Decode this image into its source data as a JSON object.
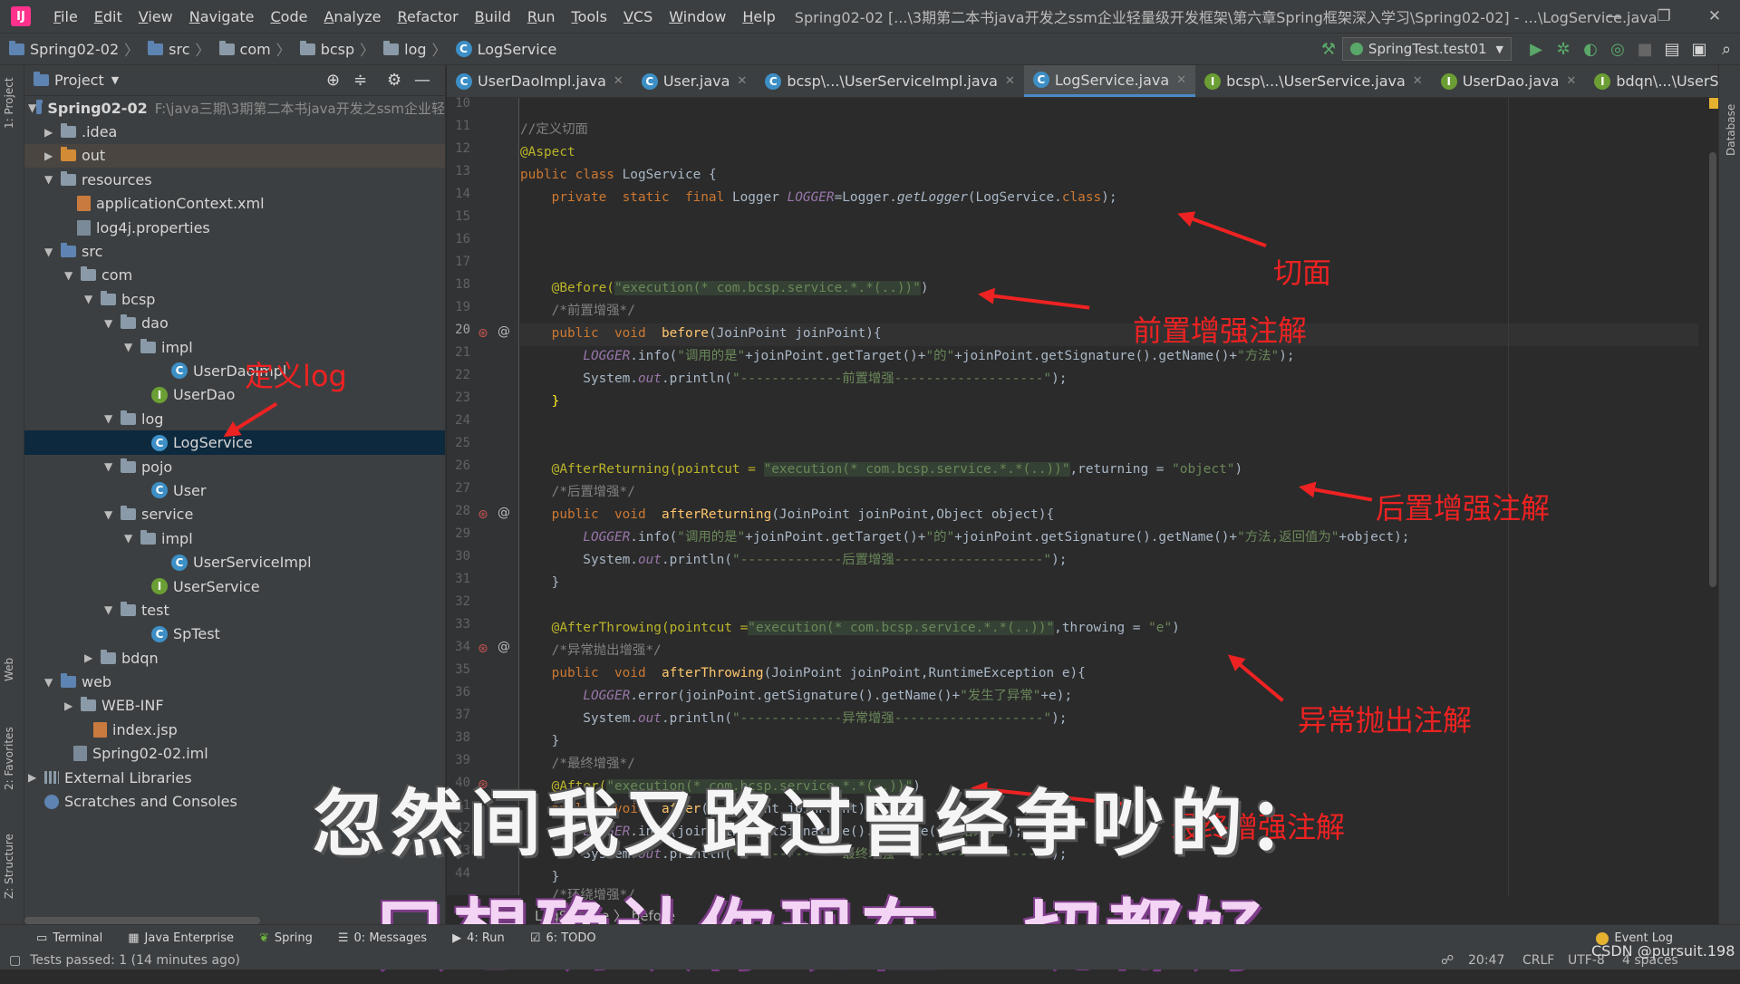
{
  "window": {
    "app_icon": "IJ",
    "menus": [
      "File",
      "Edit",
      "View",
      "Navigate",
      "Code",
      "Analyze",
      "Refactor",
      "Build",
      "Run",
      "Tools",
      "VCS",
      "Window",
      "Help"
    ],
    "title": "Spring02-02 [...\\3期第二本书java开发之ssm企业轻量级开发框架\\第六章Spring框架深入学习\\Spring02-02] - ...\\LogService.java"
  },
  "navbar": {
    "crumbs": [
      "Spring02-02",
      "src",
      "com",
      "bcsp",
      "log",
      "LogService"
    ],
    "run_config": "SpringTest.test01"
  },
  "project_panel": {
    "title": "Project",
    "tree": [
      {
        "label": "Spring02-02",
        "path": "F:\\java三期\\3期第二本书java开发之ssm企业轻"
      },
      {
        "label": ".idea"
      },
      {
        "label": "out"
      },
      {
        "label": "resources"
      },
      {
        "label": "applicationContext.xml"
      },
      {
        "label": "log4j.properties"
      },
      {
        "label": "src"
      },
      {
        "label": "com"
      },
      {
        "label": "bcsp"
      },
      {
        "label": "dao"
      },
      {
        "label": "impl"
      },
      {
        "label": "UserDaoImpl"
      },
      {
        "label": "UserDao"
      },
      {
        "label": "log"
      },
      {
        "label": "LogService"
      },
      {
        "label": "pojo"
      },
      {
        "label": "User"
      },
      {
        "label": "service"
      },
      {
        "label": "impl"
      },
      {
        "label": "UserServiceImpl"
      },
      {
        "label": "UserService"
      },
      {
        "label": "test"
      },
      {
        "label": "SpTest"
      },
      {
        "label": "bdqn"
      },
      {
        "label": "web"
      },
      {
        "label": "WEB-INF"
      },
      {
        "label": "index.jsp"
      },
      {
        "label": "Spring02-02.iml"
      },
      {
        "label": "External Libraries"
      },
      {
        "label": "Scratches and Consoles"
      }
    ]
  },
  "tabs": [
    "UserDaoImpl.java",
    "User.java",
    "bcsp\\...\\UserServiceImpl.java",
    "LogService.java",
    "bcsp\\...\\UserService.java",
    "UserDao.java",
    "bdqn\\...\\UserService."
  ],
  "line_numbers": [
    "10",
    "11",
    "12",
    "13",
    "14",
    "15",
    "16",
    "17",
    "18",
    "19",
    "20",
    "21",
    "22",
    "23",
    "24",
    "25",
    "26",
    "27",
    "28",
    "29",
    "30",
    "31",
    "32",
    "33",
    "34",
    "35",
    "36",
    "37",
    "38",
    "39",
    "40",
    "41",
    "42",
    "43",
    "44"
  ],
  "code": {
    "l11": "//定义切面",
    "l12": "@Aspect",
    "l13a": "public class ",
    "l13b": "LogService {",
    "l14a": "    private  static  final ",
    "l14b": "Logger ",
    "l14c": "LOGGER",
    "l14d": "=Logger.",
    "l14e": "getLogger",
    "l14f": "(LogService.",
    "l14g": "class",
    "l14h": ");",
    "l18a": "    @Before(",
    "l18b": "\"execution(* com.bcsp.service.*.*(..))\"",
    "l18c": ")",
    "l19": "    /*前置增强*/",
    "l20a": "    public  void  ",
    "l20b": "before",
    "l20c": "(JoinPoint joinPoint){",
    "l21a": "        ",
    "l21b": "LOGGER",
    "l21c": ".info(",
    "l21d": "\"调用的是\"",
    "l21e": "+joinPoint.getTarget()+",
    "l21f": "\"的\"",
    "l21g": "+joinPoint.getSignature().getName()+",
    "l21h": "\"方法\"",
    "l21i": ");",
    "l22a": "        System.",
    "l22b": "out",
    "l22c": ".println(",
    "l22d": "\"-------------前置增强-------------------\"",
    "l22e": ");",
    "l23": "    }",
    "l26a": "    @AfterReturning(pointcut = ",
    "l26b": "\"execution(* com.bcsp.service.*.*(..))\"",
    "l26c": ",returning = ",
    "l26d": "\"object\"",
    "l26e": ")",
    "l27": "    /*后置增强*/",
    "l28a": "    public  void  ",
    "l28b": "afterReturning",
    "l28c": "(JoinPoint joinPoint,Object object){",
    "l29a": "        ",
    "l29b": "LOGGER",
    "l29c": ".info(",
    "l29d": "\"调用的是\"",
    "l29e": "+joinPoint.getTarget()+",
    "l29f": "\"的\"",
    "l29g": "+joinPoint.getSignature().getName()+",
    "l29h": "\"方法,返回值为\"",
    "l29i": "+object);",
    "l30a": "        System.",
    "l30b": "out",
    "l30c": ".println(",
    "l30d": "\"-------------后置增强-------------------\"",
    "l30e": ");",
    "l31": "    }",
    "l33a": "    @AfterThrowing(pointcut =",
    "l33b": "\"execution(* com.bcsp.service.*.*(..))\"",
    "l33c": ",throwing = ",
    "l33d": "\"e\"",
    "l33e": ")",
    "l34": "    /*异常抛出增强*/",
    "l35a": "    public  void  ",
    "l35b": "afterThrowing",
    "l35c": "(JoinPoint joinPoint,RuntimeException e){",
    "l36a": "        ",
    "l36b": "LOGGER",
    "l36c": ".error(joinPoint.getSignature().getName()+",
    "l36d": "\"发生了异常\"",
    "l36e": "+e);",
    "l37a": "        System.",
    "l37b": "out",
    "l37c": ".println(",
    "l37d": "\"-------------异常增强-------------------\"",
    "l37e": ");",
    "l38": "    }",
    "l39": "    /*最终增强*/",
    "l40a": "    @After(",
    "l40b": "\"execution(* com.bcsp.service.*.*(..))\"",
    "l40c": ")",
    "l41a": "    public  void  ",
    "l41b": "after",
    "l41c": "(JoinPoint joinPoint){",
    "l42a": "        ",
    "l42b": "LOGGER",
    "l42c": ".info(joinPoint.getSignature().getName()+",
    "l42d": "\"结束了\"",
    "l42e": ");",
    "l43a": "        System.",
    "l43b": "out",
    "l43c": ".println(",
    "l43d": "\"-------------最终增强-------------------\"",
    "l43e": ");",
    "l44": "    }",
    "l45": "    /*环绕增强*/"
  },
  "editor_breadcrumb": "LogService  〉 before",
  "annotations": {
    "aspect": "切面",
    "before": "前置增强注解",
    "define_log": "定义log",
    "after_returning": "后置增强注解",
    "after_throwing": "异常抛出注解",
    "after": "最终增强注解"
  },
  "subtitles": {
    "line1": "忽然间我又路过曾经争吵的：",
    "line2": "只想确认你现在一切都好"
  },
  "bottom_tabs": [
    "Terminal",
    "Java Enterprise",
    "Spring",
    "0: Messages",
    "4: Run",
    "6: TODO"
  ],
  "event_log": "Event Log",
  "status": {
    "left": "Tests passed: 1 (14 minutes ago)",
    "position": "20:47",
    "line_sep": "CRLF",
    "encoding": "UTF-8",
    "indent": "4 spaces",
    "watermark": "CSDN @pursuit.198"
  },
  "side_labels": {
    "project": "1: Project",
    "web": "Web",
    "favorites": "2: Favorites",
    "structure": "Z: Structure",
    "database": "Database"
  }
}
